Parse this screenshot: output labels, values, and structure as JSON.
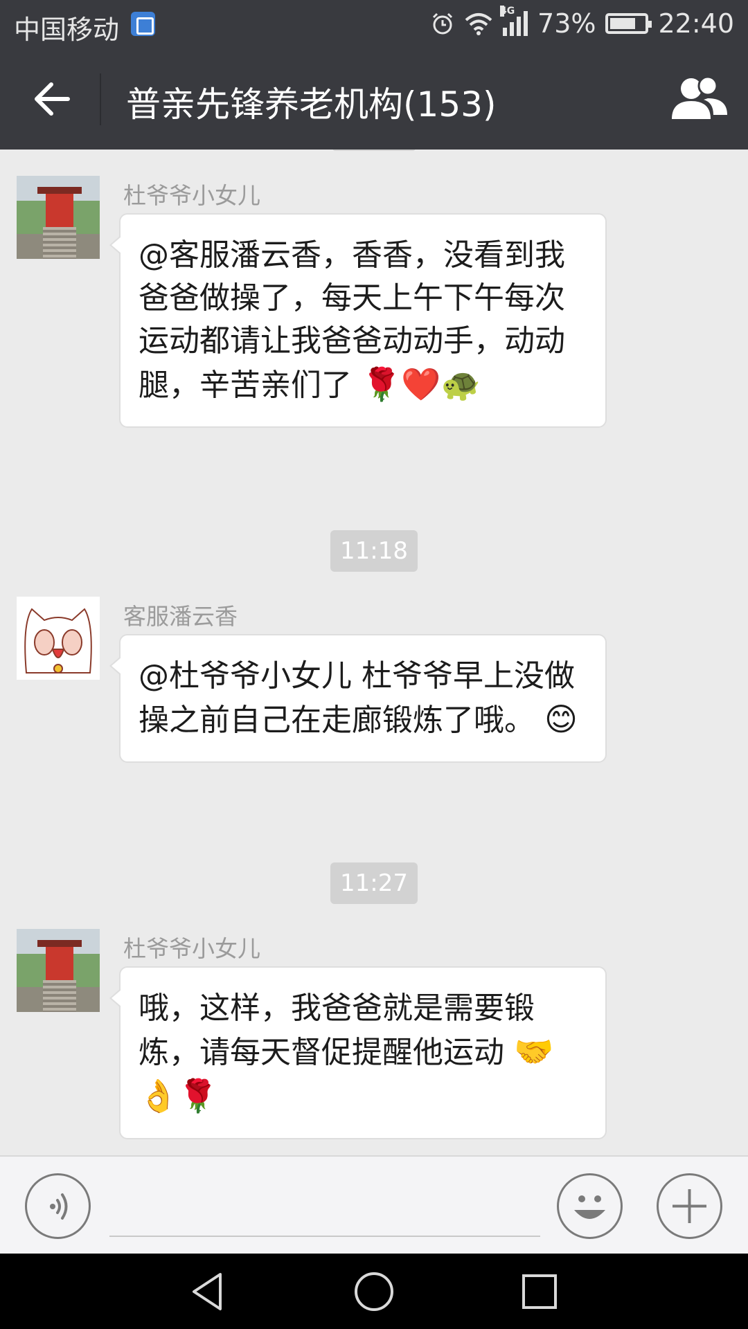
{
  "status_bar": {
    "carrier": "中国移动",
    "network": "4G",
    "battery": "73%",
    "time": "22:40"
  },
  "header": {
    "title": "普亲先锋养老机构(153)"
  },
  "messages": [
    {
      "sender": "杜爷爷小女儿",
      "text": "@客服潘云香，香香，没看到我爸爸做操了，每天上午下午每次运动都请让我爸爸动动手，动动腿，辛苦亲们了",
      "emoji": "🌹❤️🐢"
    },
    {
      "timestamp": "11:18"
    },
    {
      "sender": "客服潘云香",
      "text": "@杜爷爷小女儿 杜爷爷早上没做操之前自己在走廊锻炼了哦。",
      "emoji": "😊"
    },
    {
      "timestamp": "11:27"
    },
    {
      "sender": "杜爷爷小女儿",
      "text": "哦，这样，我爸爸就是需要锻炼，请每天督促提醒他运动",
      "emoji": "🤝👌🌹"
    }
  ],
  "input": {
    "value": ""
  },
  "colors": {
    "header_bg": "#393a3f",
    "chat_bg": "#ebebeb",
    "bubble_bg": "#ffffff"
  }
}
